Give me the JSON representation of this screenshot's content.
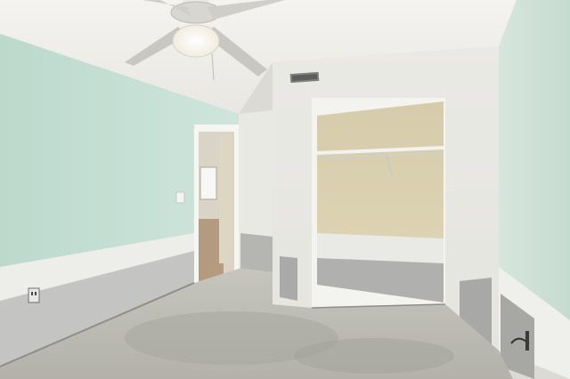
{
  "scene": {
    "description_free": true,
    "colors": {
      "ceiling": "#efeeea",
      "left_wall": "#c4ded2",
      "right_wall": "#cfe0d6",
      "back_wall": "#e6e6e1",
      "closet_interior": "#d8ceaa",
      "floor": "#bdbcb4",
      "drywall_patch": "#a9aaa7"
    },
    "icons": [
      "ceiling-fan-icon",
      "air-vent-icon",
      "light-switch-icon",
      "electrical-outlet-icon",
      "door-stop-icon"
    ]
  }
}
